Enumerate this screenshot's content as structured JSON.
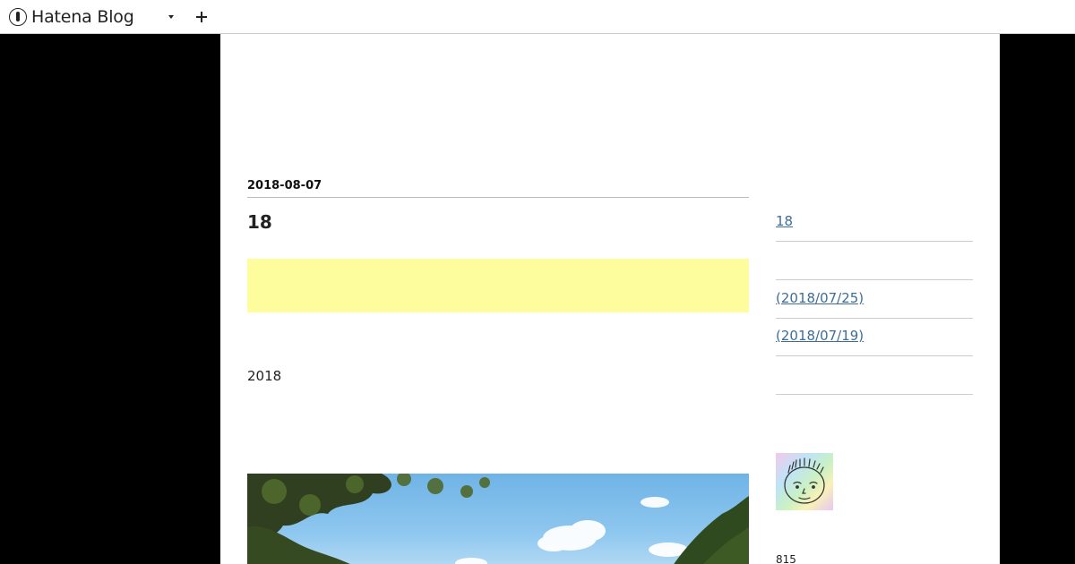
{
  "header": {
    "brand": "Hatena Blog",
    "menu_icon": "chevron-down-icon",
    "add_icon": "plus-icon"
  },
  "entry": {
    "date": "2018-08-07",
    "title": "18",
    "paragraph": "2018"
  },
  "sidebar": {
    "links": [
      {
        "label": "18"
      },
      {
        "label": " (2018/07/25) "
      },
      {
        "label": " (2018/07/19) "
      }
    ],
    "profile_count": "815"
  },
  "colors": {
    "background": "#000000",
    "page": "#ffffff",
    "highlight": "#fdfd9e",
    "link": "#3f6d96"
  }
}
